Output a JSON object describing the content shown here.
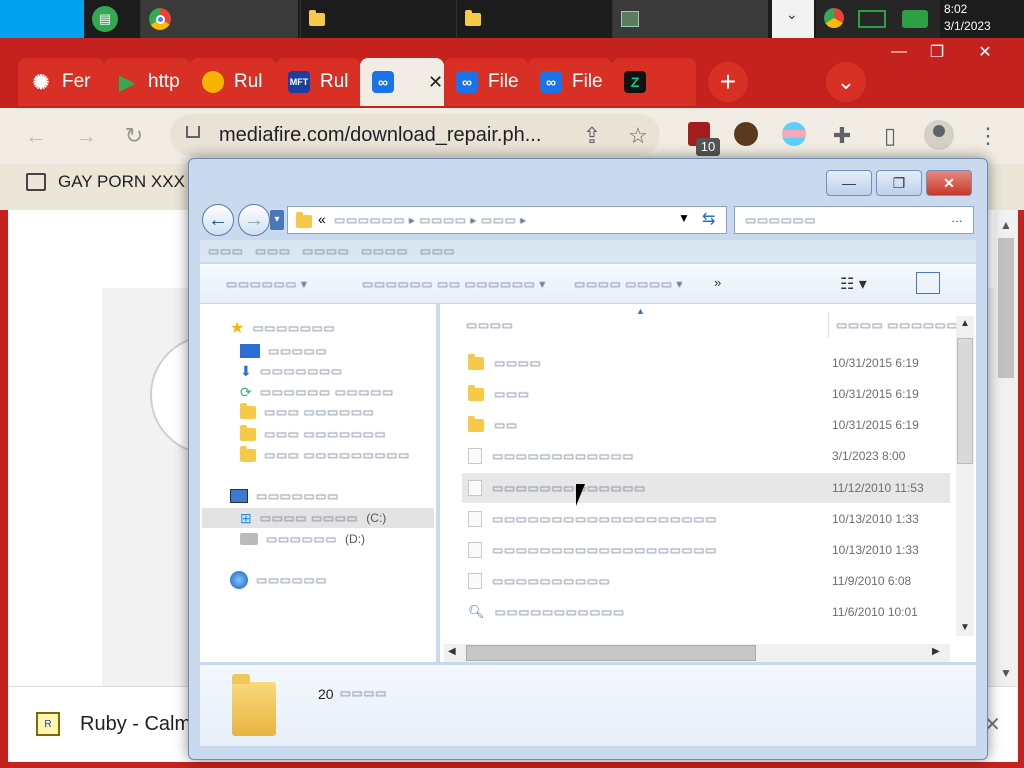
{
  "taskbar": {
    "items": [
      {
        "label": "",
        "icon": "sheets-icon"
      },
      {
        "label": "",
        "icon": "chrome-icon"
      },
      {
        "label": "",
        "icon": "folder-icon"
      },
      {
        "label": "",
        "icon": "folder-icon"
      },
      {
        "label": "",
        "icon": "terminal-icon"
      }
    ],
    "time": "8:02",
    "date": "3/1/2023"
  },
  "browser": {
    "tabs": [
      {
        "label": "Fer",
        "icon": "shell-icon",
        "color": "#e8f0fe"
      },
      {
        "label": "http",
        "icon": "play-icon",
        "color": "#34a853"
      },
      {
        "label": "Rul",
        "icon": "mushroom-icon",
        "color": "#f4b400"
      },
      {
        "label": "Rul",
        "icon": "mft-icon",
        "color": "#1a3fa0"
      },
      {
        "label": "",
        "icon": "mediafire-icon",
        "color": "#1a73e8",
        "active": true
      },
      {
        "label": "File",
        "icon": "mediafire-icon",
        "color": "#1a73e8"
      },
      {
        "label": "File",
        "icon": "mediafire-icon",
        "color": "#1a73e8"
      },
      {
        "label": "",
        "icon": "z-icon",
        "color": "#00d084"
      }
    ],
    "close_glyph": "✕",
    "new_tab": "+",
    "tab_menu": "⌄",
    "window_controls": {
      "minimize": "—",
      "maximize": "❐",
      "close": "✕"
    },
    "url": "mediafire.com/download_repair.ph...",
    "extension_badge": "10",
    "bookmark_label": "GAY PORN XXX",
    "download_item": "Ruby - Calm"
  },
  "explorer": {
    "window_controls": {
      "minimize": "—",
      "maximize": "❐",
      "close": "✕"
    },
    "back_glyph": "←",
    "forward_glyph": "→",
    "overflow_glyph": "»",
    "nav_items": [
      {
        "label": "",
        "icon": "star-icon",
        "drive": ""
      },
      {
        "label": "",
        "icon": "desktop-icon",
        "drive": ""
      },
      {
        "label": "",
        "icon": "downloads-icon",
        "drive": ""
      },
      {
        "label": "",
        "icon": "recent-places-icon",
        "drive": ""
      },
      {
        "label": "",
        "icon": "folder-icon",
        "drive": ""
      },
      {
        "label": "",
        "icon": "folder-icon",
        "drive": ""
      },
      {
        "label": "",
        "icon": "folder-icon",
        "drive": ""
      },
      {
        "label": "",
        "icon": "computer-icon",
        "drive": ""
      },
      {
        "label": "",
        "icon": "windows-drive-icon",
        "drive": "(C:)"
      },
      {
        "label": "",
        "icon": "dvd-drive-icon",
        "drive": "(D:)"
      },
      {
        "label": "",
        "icon": "network-icon",
        "drive": ""
      }
    ],
    "files": [
      {
        "icon": "folder",
        "date": "10/31/2015 6:19"
      },
      {
        "icon": "folder",
        "date": "10/31/2015 6:19"
      },
      {
        "icon": "folder",
        "date": "10/31/2015 6:19"
      },
      {
        "icon": "doc",
        "date": "3/1/2023 8:00"
      },
      {
        "icon": "doc",
        "date": "11/12/2010 11:53"
      },
      {
        "icon": "doc",
        "date": "10/13/2010 1:33"
      },
      {
        "icon": "doc",
        "date": "10/13/2010 1:33"
      },
      {
        "icon": "doc",
        "date": "11/9/2010 6:08"
      },
      {
        "icon": "doc",
        "date": "11/6/2010 10:01"
      }
    ],
    "item_count": "20"
  }
}
